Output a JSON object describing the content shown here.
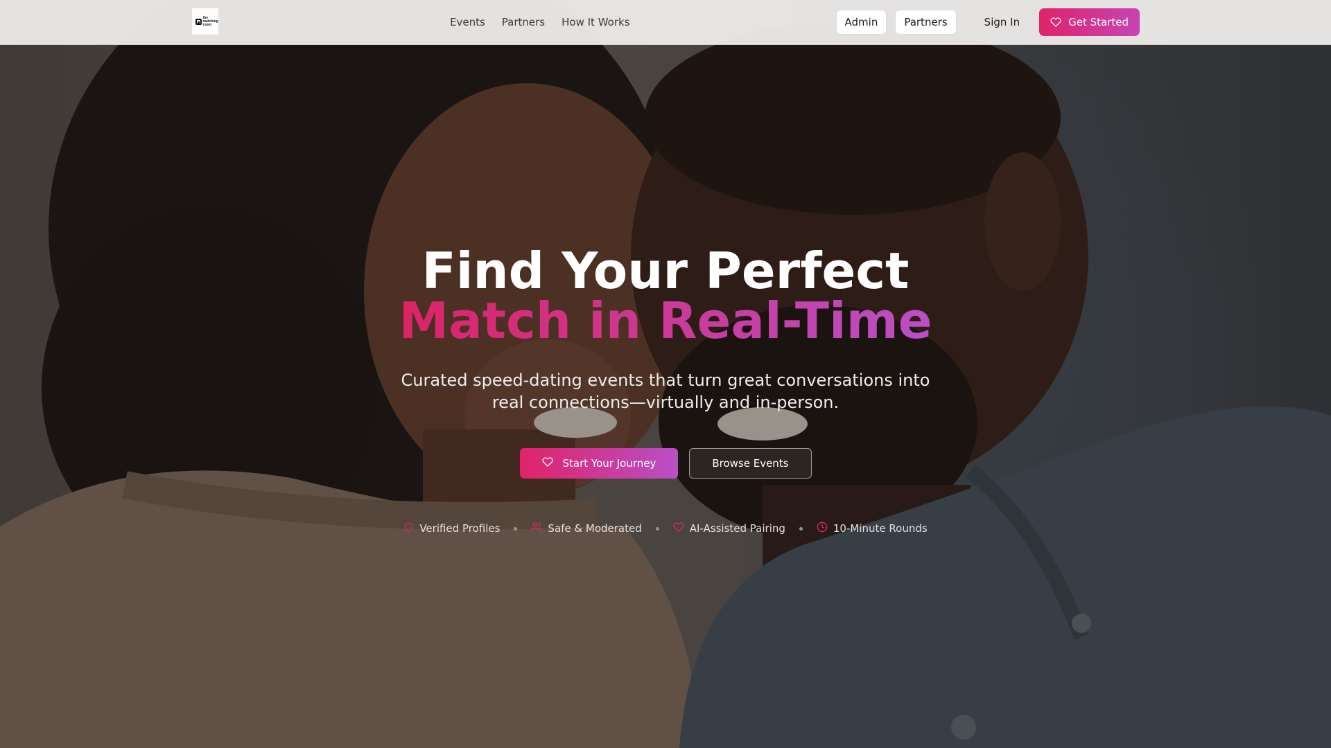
{
  "brand": {
    "logo_text": "the matching room",
    "accent_start": "#e0236a",
    "accent_end": "#b94fc6"
  },
  "nav": {
    "links": [
      {
        "label": "Events"
      },
      {
        "label": "Partners"
      },
      {
        "label": "How It Works"
      }
    ],
    "admin_label": "Admin",
    "partners_label": "Partners",
    "signin_label": "Sign In",
    "get_started_label": "Get Started",
    "get_started_icon": "heart-icon"
  },
  "hero": {
    "headline_line1": "Find Your Perfect",
    "headline_line2": "Match in Real-Time",
    "subtitle": "Curated speed-dating events that turn great conversations into real connections—virtually and in-person.",
    "primary_cta": "Start Your Journey",
    "primary_cta_icon": "heart-icon",
    "secondary_cta": "Browse Events",
    "background": "couple-photo"
  },
  "features": [
    {
      "label": "Verified Profiles",
      "icon": "shield-icon"
    },
    {
      "label": "Safe & Moderated",
      "icon": "users-icon"
    },
    {
      "label": "AI-Assisted Pairing",
      "icon": "heart-icon"
    },
    {
      "label": "10-Minute Rounds",
      "icon": "clock-icon"
    }
  ]
}
